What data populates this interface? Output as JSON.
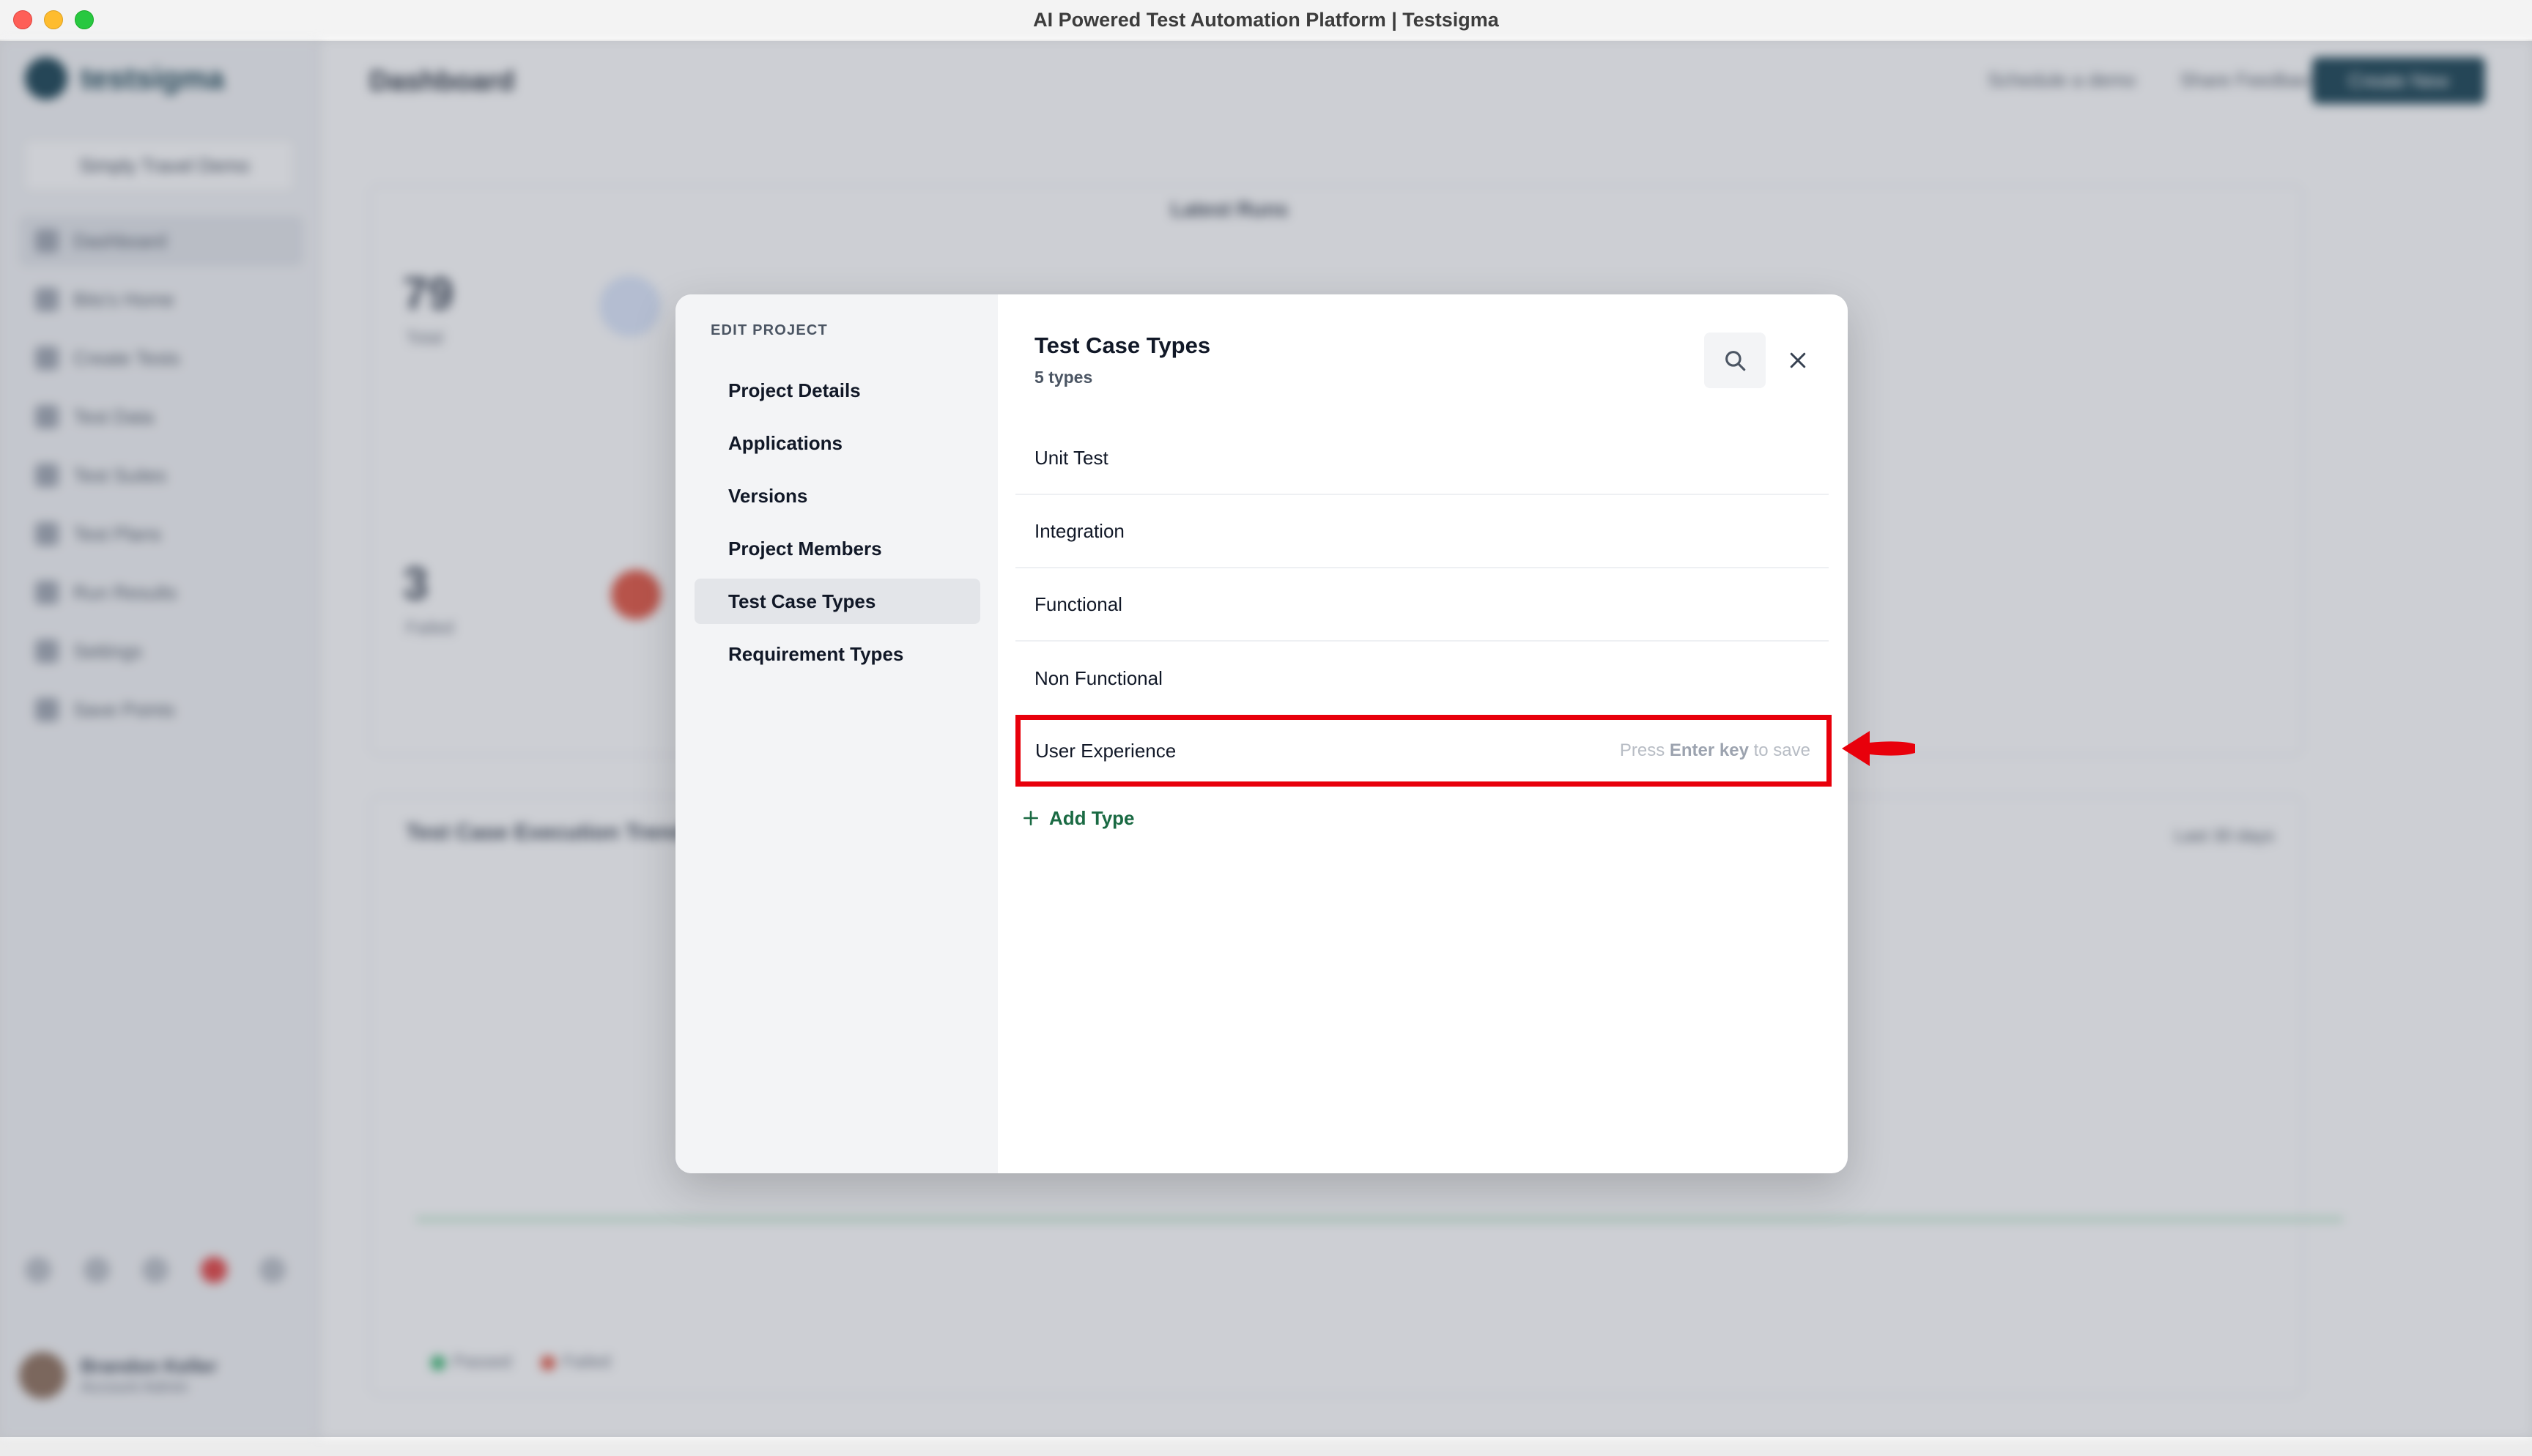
{
  "window": {
    "title": "AI Powered Test Automation Platform | Testsigma"
  },
  "background": {
    "brand": "testsigma",
    "project_switcher": "Simply Travel Demo",
    "sidebar_items": [
      "Dashboard",
      "Bits's Home",
      "Create Tests",
      "Test Data",
      "Test Suites",
      "Test Plans",
      "Run Results",
      "Settings",
      "Save Points"
    ],
    "page_title": "Dashboard",
    "schedule_demo": "Schedule a demo",
    "share_feedback": "Share Feedback",
    "create_new": "Create New",
    "latest_runs": "Latest Runs",
    "stat_total_value": "79",
    "stat_total_label": "Total",
    "stat_failed_value": "3",
    "stat_failed_label": "Failed",
    "execution_trend_title": "Test Case Execution Trend",
    "range": "Last 30 days",
    "legend_passed": "Passed",
    "legend_failed": "Failed",
    "user_name": "Brandon Keller",
    "user_role": "Account Admin"
  },
  "modal": {
    "nav_heading": "EDIT PROJECT",
    "nav_items": [
      {
        "label": "Project Details"
      },
      {
        "label": "Applications"
      },
      {
        "label": "Versions"
      },
      {
        "label": "Project Members"
      },
      {
        "label": "Test Case Types"
      },
      {
        "label": "Requirement Types"
      }
    ],
    "active_nav": "Test Case Types",
    "title": "Test Case Types",
    "subtitle": "5 types",
    "types": [
      {
        "label": "Unit Test"
      },
      {
        "label": "Integration"
      },
      {
        "label": "Functional"
      },
      {
        "label": "Non Functional"
      }
    ],
    "edit_field": {
      "value": "User Experience",
      "hint_prefix": "Press ",
      "hint_key": "Enter key",
      "hint_suffix": " to save"
    },
    "add_type_label": "Add Type"
  },
  "colors": {
    "annotation": "#e8000b",
    "accent_green": "#1a6a43",
    "brand_dark": "#0f3b4c"
  },
  "icons": {
    "search": "search-icon",
    "close": "close-icon",
    "add": "plus-icon"
  }
}
